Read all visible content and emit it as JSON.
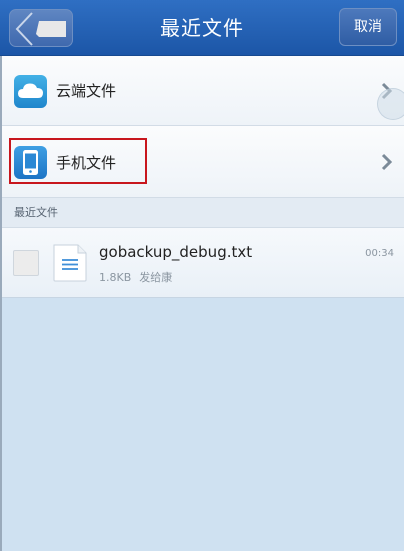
{
  "header": {
    "title": "最近文件",
    "cancel_label": "取消"
  },
  "entries": [
    {
      "label": "云端文件",
      "icon": "cloud-icon"
    },
    {
      "label": "手机文件",
      "icon": "phone-icon"
    }
  ],
  "section": {
    "title": "最近文件"
  },
  "files": [
    {
      "name": "gobackup_debug.txt",
      "size": "1.8KB",
      "sender": "发给康",
      "time": "00:34",
      "icon": "text-file-icon",
      "checked": false
    }
  ],
  "colors": {
    "header_blue": "#2f6fc3",
    "highlight_red": "#c8161d",
    "background": "#cfe1f1"
  }
}
